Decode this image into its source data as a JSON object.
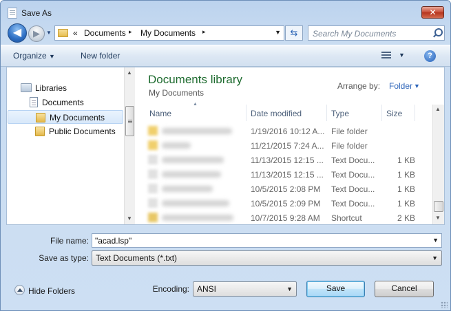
{
  "window": {
    "title": "Save As",
    "close_label": "✕"
  },
  "navigation": {
    "back_glyph": "◀",
    "forward_glyph": "▶",
    "address": {
      "chevron": "«",
      "segments": [
        "Documents",
        "My Documents"
      ],
      "separator": "▸"
    },
    "search_placeholder": "Search My Documents"
  },
  "toolbar": {
    "organize": "Organize",
    "new_folder": "New folder",
    "help": "?"
  },
  "sidebar": {
    "items": [
      {
        "label": "Libraries",
        "icon": "libraries-icon"
      },
      {
        "label": "Documents",
        "icon": "documents-icon"
      },
      {
        "label": "My Documents",
        "icon": "folder-icon",
        "selected": true
      },
      {
        "label": "Public Documents",
        "icon": "folder-icon"
      }
    ]
  },
  "content": {
    "title": "Documents library",
    "subtitle": "My Documents",
    "arrange_label": "Arrange by:",
    "arrange_value": "Folder",
    "columns": [
      "Name",
      "Date modified",
      "Type",
      "Size"
    ],
    "rows": [
      {
        "date": "1/19/2016 10:12 A...",
        "type": "File folder",
        "size": ""
      },
      {
        "date": "11/21/2015 7:24 A...",
        "type": "File folder",
        "size": ""
      },
      {
        "date": "11/13/2015 12:15 ...",
        "type": "Text Docu...",
        "size": "1 KB"
      },
      {
        "date": "11/13/2015 12:15 ...",
        "type": "Text Docu...",
        "size": "1 KB"
      },
      {
        "date": "10/5/2015 2:08 PM",
        "type": "Text Docu...",
        "size": "1 KB"
      },
      {
        "date": "10/5/2015 2:09 PM",
        "type": "Text Docu...",
        "size": "1 KB"
      },
      {
        "date": "10/7/2015 9:28 AM",
        "type": "Shortcut",
        "size": "2 KB"
      }
    ]
  },
  "form": {
    "filename_label": "File name:",
    "filename_value": "\"acad.lsp\"",
    "savetype_label": "Save as type:",
    "savetype_value": "Text Documents (*.txt)"
  },
  "footer": {
    "hide_folders": "Hide Folders",
    "encoding_label": "Encoding:",
    "encoding_value": "ANSI",
    "save": "Save",
    "cancel": "Cancel"
  }
}
